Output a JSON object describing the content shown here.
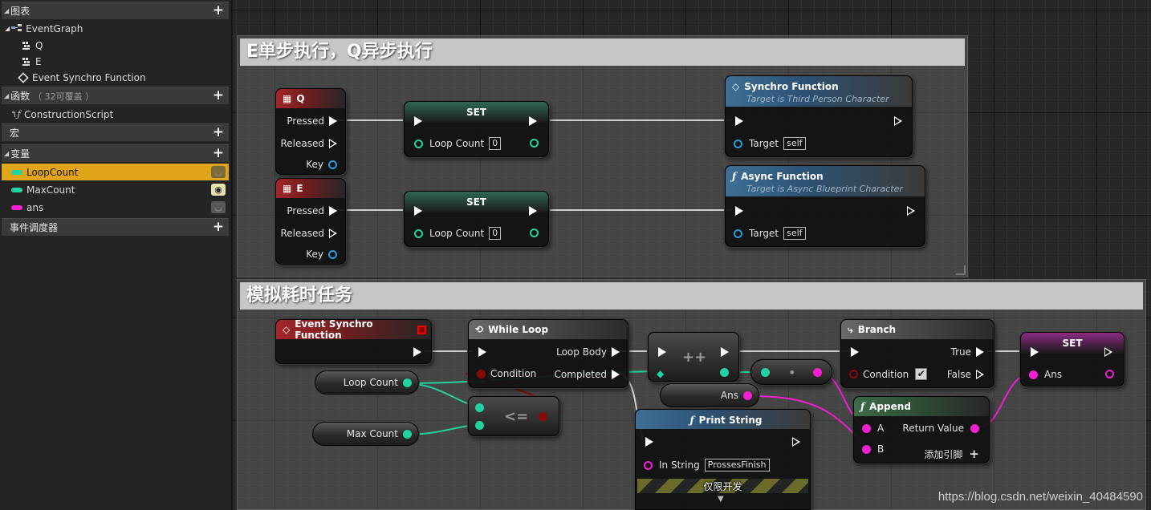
{
  "panel": {
    "sections": {
      "graphs": "图表",
      "functions": "函数",
      "functions_sub": "（ 32可覆盖 ）",
      "macros": "宏",
      "variables": "变量",
      "dispatchers": "事件调度器"
    },
    "graph_items": [
      "EventGraph",
      "Q",
      "E",
      "Event Synchro Function"
    ],
    "function_items": [
      "ConstructionScript"
    ],
    "variables": [
      {
        "name": "LoopCount",
        "color": "#22d3a2",
        "selected": true
      },
      {
        "name": "MaxCount",
        "color": "#22d3a2",
        "selected": false
      },
      {
        "name": "ans",
        "color": "#f01fd2",
        "selected": false
      }
    ]
  },
  "comments": {
    "top": "E单步执行，Q异步执行",
    "bottom": "模拟耗时任务"
  },
  "nodes": {
    "q_event": {
      "title": "Q",
      "pressed": "Pressed",
      "released": "Released",
      "key": "Key"
    },
    "e_event": {
      "title": "E",
      "pressed": "Pressed",
      "released": "Released",
      "key": "Key"
    },
    "set1": {
      "title": "SET",
      "pin": "Loop Count",
      "value": "0"
    },
    "set2": {
      "title": "SET",
      "pin": "Loop Count",
      "value": "0"
    },
    "synchro": {
      "title": "Synchro Function",
      "subtitle": "Target is Third Person Character",
      "target": "Target",
      "target_value": "self"
    },
    "async": {
      "title": "Async Function",
      "subtitle": "Target is Async Blueprint Character",
      "target": "Target",
      "target_value": "self"
    },
    "event_synchro": {
      "title": "Event Synchro Function"
    },
    "while_loop": {
      "title": "While Loop",
      "loop_body": "Loop Body",
      "condition": "Condition",
      "completed": "Completed"
    },
    "get_loop_count": {
      "label": "Loop Count"
    },
    "get_max_count": {
      "label": "Max Count"
    },
    "lte": {
      "label": "<="
    },
    "increment": {
      "label": "++"
    },
    "convert": {
      "label": "•"
    },
    "get_ans": {
      "label": "Ans"
    },
    "branch": {
      "title": "Branch",
      "condition": "Condition",
      "true": "True",
      "false": "False"
    },
    "set_ans": {
      "title": "SET",
      "pin": "Ans"
    },
    "append": {
      "title": "Append",
      "a": "A",
      "b": "B",
      "return_value": "Return Value",
      "add_pin": "添加引脚",
      "add_pin_icon": "+"
    },
    "print_string": {
      "title": "Print String",
      "in_string": "In String",
      "in_string_value": "ProssesFinish",
      "dev_only": "仅限开发",
      "expand": "▼"
    }
  },
  "colors": {
    "selection": "#e0a51a",
    "integer": "#22d3a2",
    "string": "#f01fd2",
    "object": "#2a9ad8",
    "bool": "#8a0a0a"
  },
  "watermark": "https://blog.csdn.net/weixin_40484590"
}
